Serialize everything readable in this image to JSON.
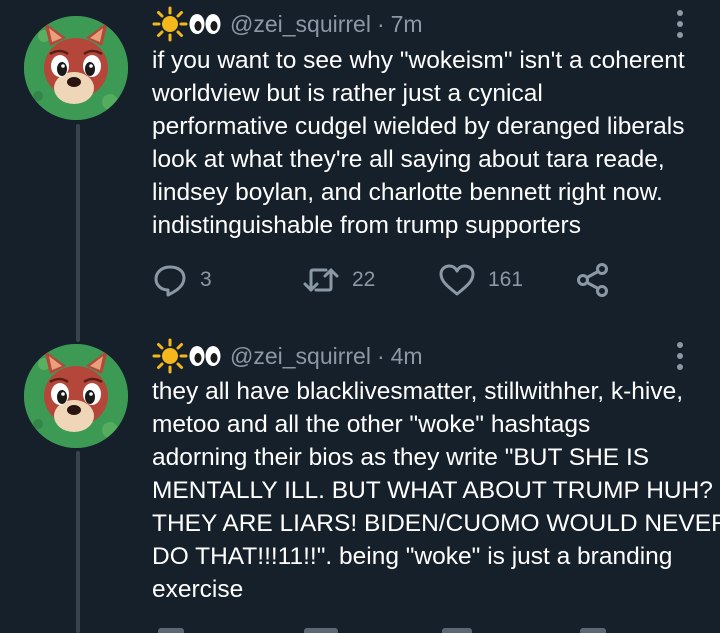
{
  "tweets": [
    {
      "handle": "@zei_squirrel",
      "separator": "·",
      "time": "7m",
      "lines": [
        "if you want to see why \"wokeism\" isn't a coherent",
        "worldview but is rather just a cynical",
        "performative cudgel wielded by deranged liberals",
        "look at what they're all saying about tara reade,",
        "lindsey boylan, and charlotte bennett right now.",
        "indistinguishable from trump supporters"
      ],
      "replies": "3",
      "retweets": "22",
      "likes": "161"
    },
    {
      "handle": "@zei_squirrel",
      "separator": "·",
      "time": "4m",
      "lines": [
        "they all have blacklivesmatter, stillwithher, k-hive,",
        "metoo and all the other \"woke\" hashtags",
        "adorning their bios as they write \"BUT SHE IS",
        "MENTALLY ILL. BUT WHAT ABOUT TRUMP HUH?",
        "THEY ARE LIARS! BIDEN/CUOMO WOULD NEVER",
        "DO THAT!!!11!!\". being \"woke\" is just a branding",
        "exercise"
      ]
    }
  ],
  "icons": {
    "name_emoji": [
      "sun-icon",
      "eyes-icon"
    ],
    "reply": "reply-icon",
    "retweet": "retweet-icon",
    "like": "heart-icon",
    "share": "share-icon",
    "more": "more-vertical-icon"
  },
  "colors": {
    "background": "#15202b",
    "text": "#ffffff",
    "secondary": "#8b98a5",
    "thread_line": "#38444d",
    "avatar_bg": "#3d9a54",
    "squirrel": "#b5463a",
    "sun": "#f5b81c"
  }
}
